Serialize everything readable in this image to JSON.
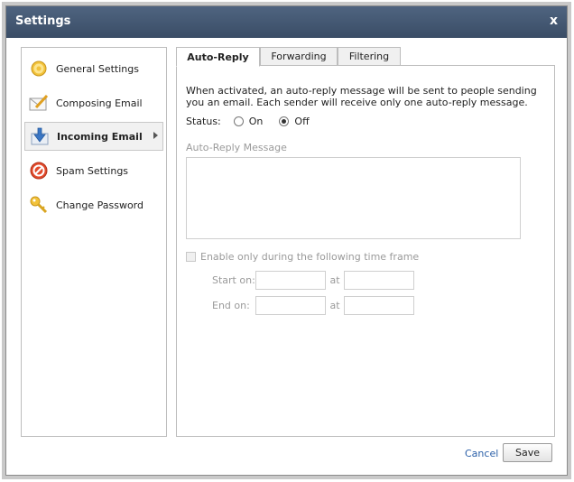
{
  "window": {
    "title": "Settings",
    "close_label": "x"
  },
  "sidebar": {
    "items": [
      {
        "label": "General Settings",
        "icon": "gear-icon"
      },
      {
        "label": "Composing Email",
        "icon": "compose-icon"
      },
      {
        "label": "Incoming Email",
        "icon": "download-icon",
        "active": true
      },
      {
        "label": "Spam Settings",
        "icon": "no-entry-icon"
      },
      {
        "label": "Change Password",
        "icon": "key-icon"
      }
    ]
  },
  "tabs": [
    {
      "label": "Auto-Reply",
      "active": true
    },
    {
      "label": "Forwarding"
    },
    {
      "label": "Filtering"
    }
  ],
  "autoreply": {
    "description": "When activated, an auto-reply message will be sent to people sending you an email. Each sender will receive only one auto-reply message.",
    "status_label": "Status:",
    "on_label": "On",
    "off_label": "Off",
    "selected": "Off",
    "message_label": "Auto-Reply Message",
    "message_value": "",
    "timeframe_label": "Enable only during the following time frame",
    "start_label": "Start on:",
    "end_label": "End on:",
    "at_label": "at"
  },
  "footer": {
    "cancel_label": "Cancel",
    "save_label": "Save"
  },
  "colors": {
    "titlebar": "#42566f",
    "link": "#2a5fa8",
    "disabled_text": "#9a9a9a"
  }
}
